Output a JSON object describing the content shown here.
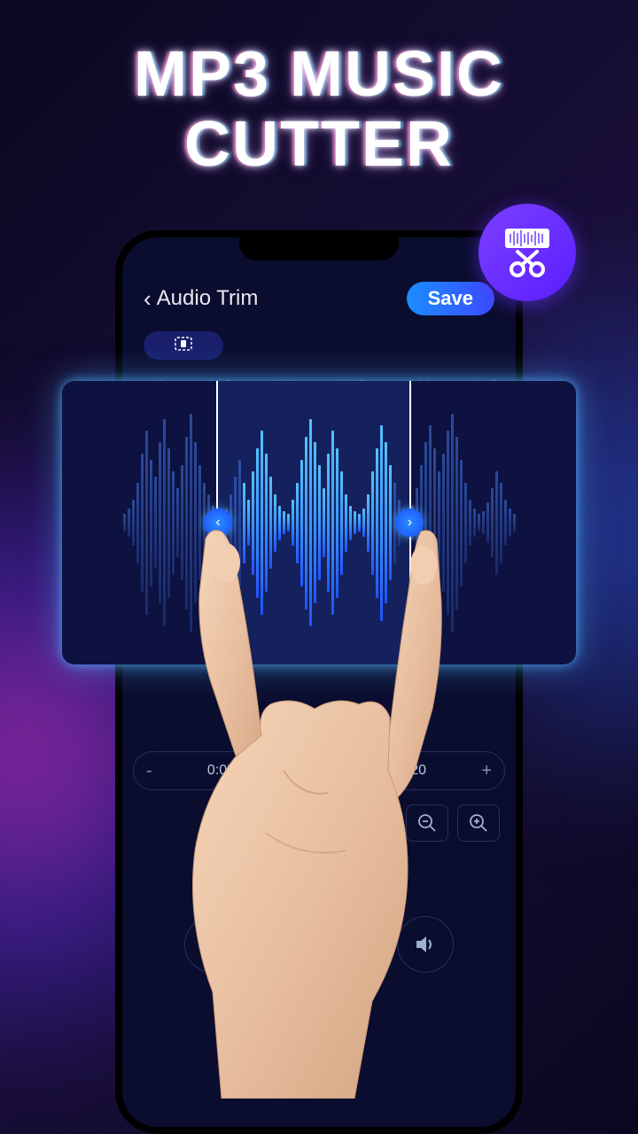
{
  "promo": {
    "line1": "MP3 MUSIC",
    "line2": "CUTTER"
  },
  "header": {
    "back_label": "Audio Trim",
    "save_label": "Save"
  },
  "timeline": {
    "marks": [
      "0:00",
      "0:05",
      "0:10",
      "0:15",
      "0:20",
      "0:25"
    ]
  },
  "trim": {
    "start": {
      "value": "0:05",
      "minus": "-",
      "plus": "+"
    },
    "end": {
      "value": "0:20",
      "minus": "-",
      "plus": "+"
    },
    "selection_left_pct": 30,
    "selection_width_pct": 38
  },
  "icons": {
    "chevron_left": "‹",
    "handle_left": "‹",
    "handle_right": "›",
    "crop": "⧈",
    "zoom_out": "⊖",
    "zoom_in": "⊕",
    "restart": "↻",
    "volume": "🔊"
  },
  "waveform": {
    "bars": [
      8,
      12,
      20,
      35,
      60,
      80,
      55,
      40,
      70,
      90,
      65,
      45,
      30,
      50,
      75,
      95,
      70,
      50,
      35,
      25,
      15,
      10,
      8,
      12,
      25,
      40,
      55,
      35,
      20,
      45,
      65,
      80,
      60,
      40,
      25,
      15,
      10,
      8,
      20,
      35,
      55,
      75,
      90,
      70,
      50,
      30,
      60,
      80,
      65,
      45,
      25,
      15,
      10,
      8,
      12,
      25,
      45,
      65,
      85,
      70,
      50,
      35,
      20,
      12,
      8,
      15,
      30,
      50,
      70,
      85,
      65,
      45,
      60,
      80,
      95,
      75,
      55,
      35,
      20,
      12,
      8,
      10,
      18,
      30,
      45,
      35,
      20,
      12,
      8
    ]
  }
}
